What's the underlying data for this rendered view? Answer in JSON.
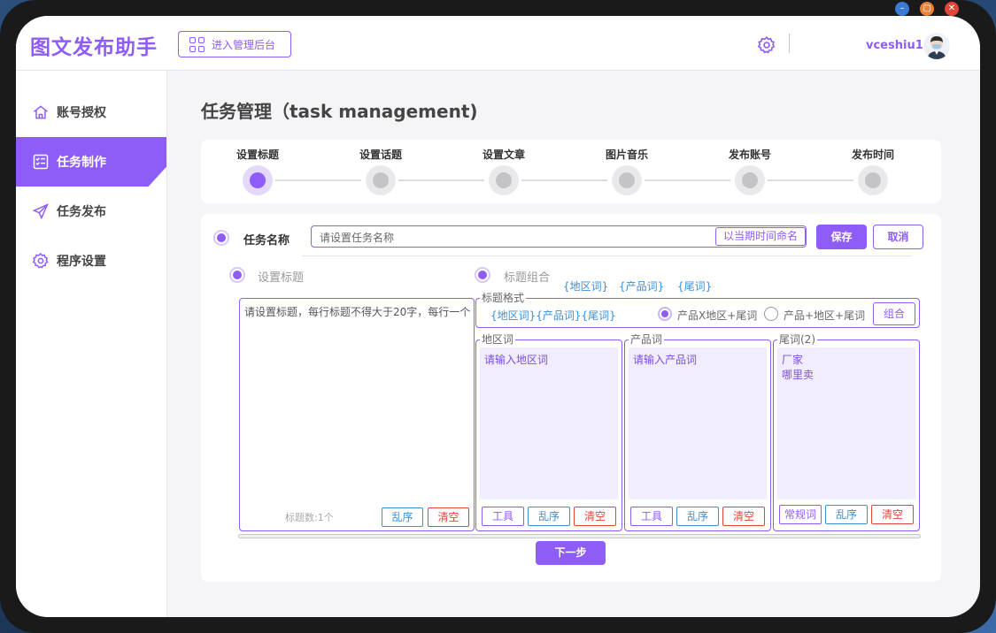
{
  "app": {
    "title": "图文发布助手",
    "admin_button": "进入管理后台",
    "username": "vceshiu1"
  },
  "sidebar": {
    "items": [
      {
        "label": "账号授权",
        "icon": "home-icon",
        "active": false
      },
      {
        "label": "任务制作",
        "icon": "checklist-icon",
        "active": true
      },
      {
        "label": "任务发布",
        "icon": "send-icon",
        "active": false
      },
      {
        "label": "程序设置",
        "icon": "gear-icon",
        "active": false
      }
    ]
  },
  "page": {
    "title": "任务管理（task management)"
  },
  "steps": [
    {
      "label": "设置标题",
      "active": true
    },
    {
      "label": "设置话题",
      "active": false
    },
    {
      "label": "设置文章",
      "active": false
    },
    {
      "label": "图片音乐",
      "active": false
    },
    {
      "label": "发布账号",
      "active": false
    },
    {
      "label": "发布时间",
      "active": false
    }
  ],
  "task": {
    "name_label": "任务名称",
    "name_placeholder": "请设置任务名称",
    "name_by_time": "以当期时间命名",
    "save": "保存",
    "cancel": "取消"
  },
  "title_setting": {
    "label": "设置标题",
    "placeholder": "请设置标题，每行标题不得大于20字，每行一个",
    "count": "标题数:1个",
    "shuffle": "乱序",
    "clear": "清空"
  },
  "combination": {
    "label": "标题组合",
    "vars": [
      "{地区词}",
      "{产品词}",
      "{尾词}"
    ],
    "format_legend": "标题格式",
    "format_value": "{地区词}{产品词}{尾词}",
    "options": [
      {
        "label": "产品X地区+尾词",
        "selected": true
      },
      {
        "label": "产品+地区+尾词",
        "selected": false
      }
    ],
    "combine_button": "组合"
  },
  "words": {
    "region": {
      "legend": "地区词",
      "placeholder": "请输入地区词",
      "tool": "工具",
      "shuffle": "乱序",
      "clear": "清空"
    },
    "product": {
      "legend": "产品词",
      "placeholder": "请输入产品词",
      "tool": "工具",
      "shuffle": "乱序",
      "clear": "清空"
    },
    "tail": {
      "legend": "尾词(2)",
      "lines": [
        "厂家",
        "哪里卖"
      ],
      "common": "常规词",
      "shuffle": "乱序",
      "clear": "清空"
    }
  },
  "next_button": "下一步",
  "colors": {
    "accent": "#8e5cf7",
    "blue": "#3a8fd6",
    "red": "#e0453a"
  }
}
